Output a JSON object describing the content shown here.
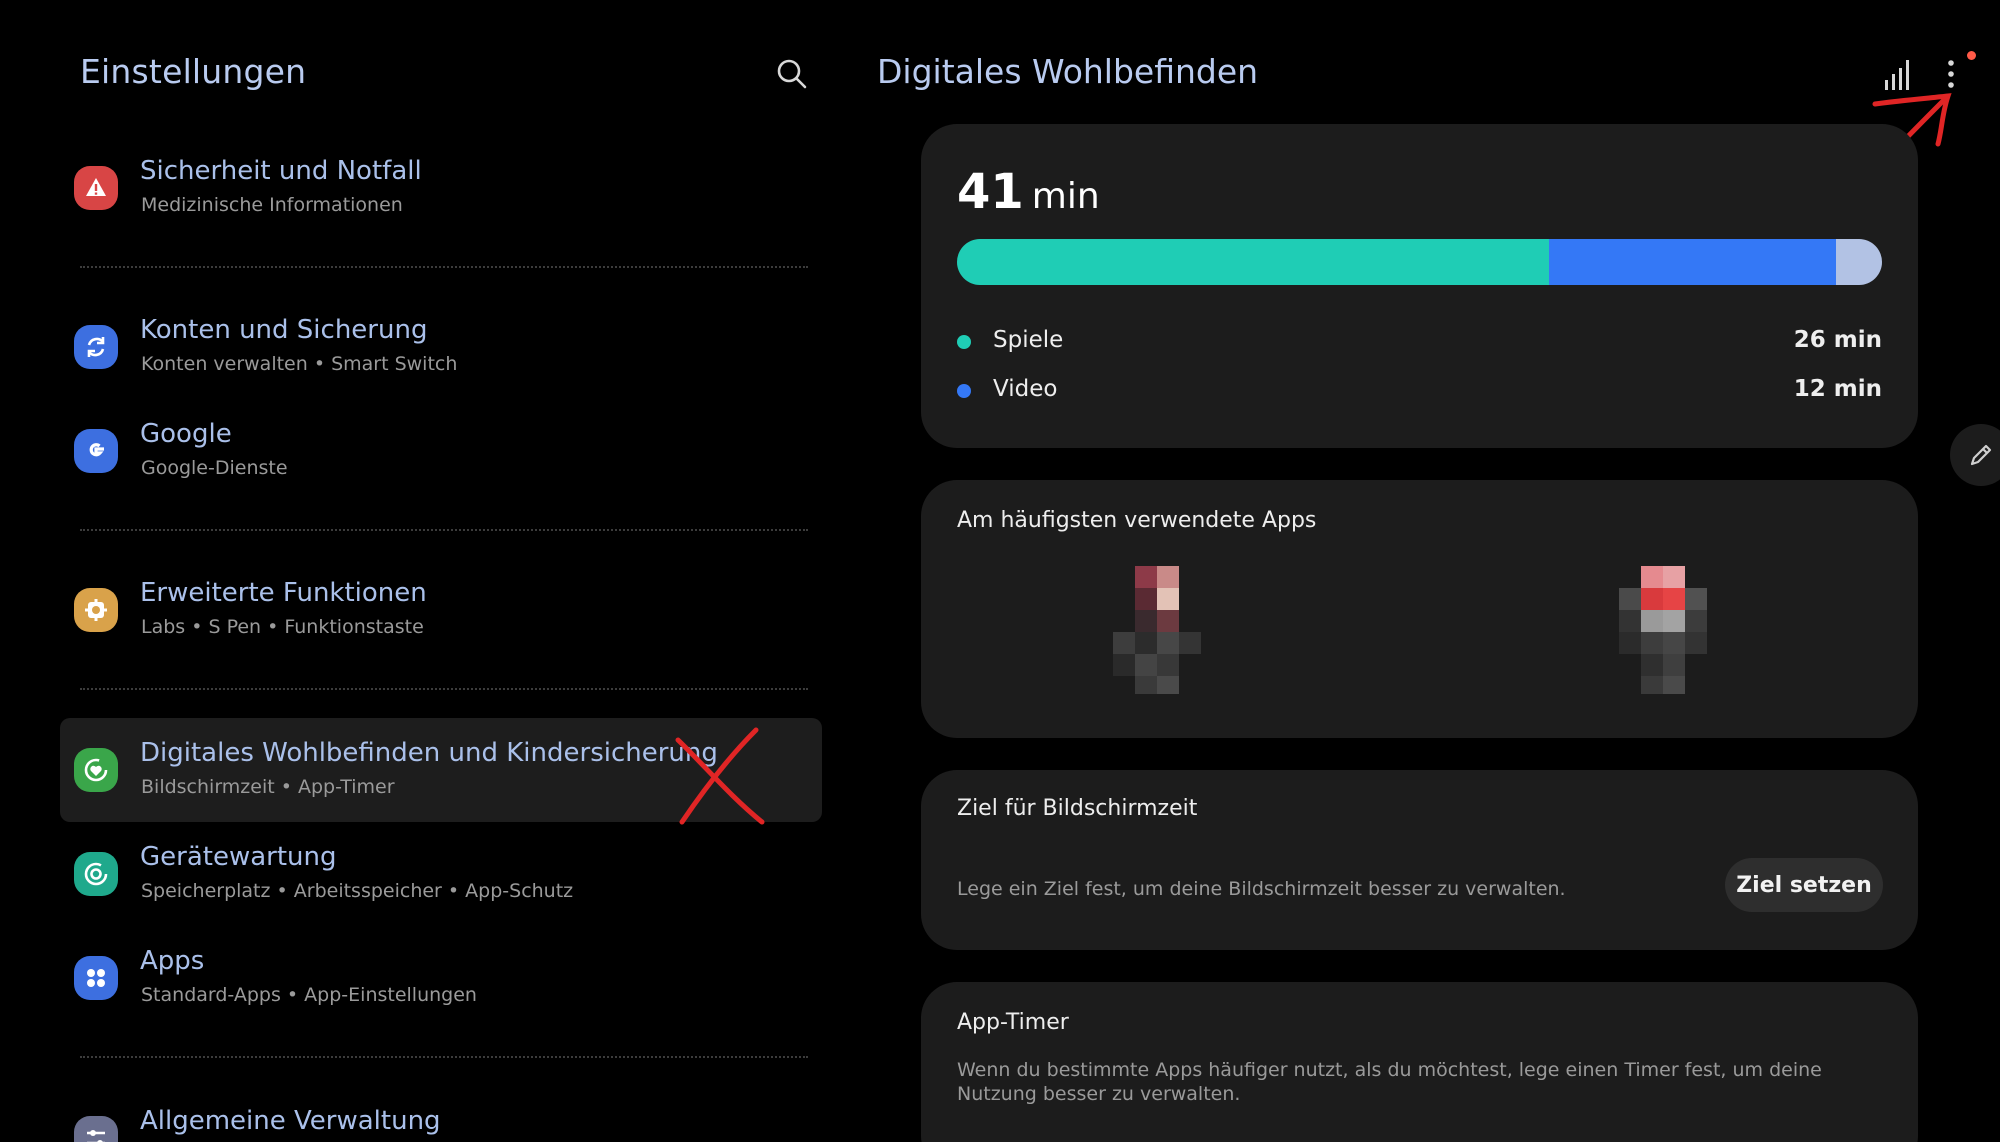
{
  "left": {
    "title": "Einstellungen",
    "items": [
      {
        "title": "Sicherheit und Notfall",
        "subtitle": "Medizinische Informationen",
        "icon": "alert-icon",
        "color": "#d84545"
      },
      {
        "title": "Konten und Sicherung",
        "subtitle": "Konten verwalten  •  Smart Switch",
        "icon": "sync-icon",
        "color": "#3d6fe0"
      },
      {
        "title": "Google",
        "subtitle": "Google-Dienste",
        "icon": "google-icon",
        "color": "#3d6fe0"
      },
      {
        "title": "Erweiterte Funktionen",
        "subtitle": "Labs  •  S Pen  •  Funktionstaste",
        "icon": "puzzle-gear-icon",
        "color": "#d9a24a"
      },
      {
        "title": "Digitales Wohlbefinden und Kindersicherung",
        "subtitle": "Bildschirmzeit  •  App-Timer",
        "icon": "wellbeing-icon",
        "color": "#3aa64a"
      },
      {
        "title": "Gerätewartung",
        "subtitle": "Speicherplatz  •  Arbeitsspeicher  •  App-Schutz",
        "icon": "device-care-icon",
        "color": "#1fa98c"
      },
      {
        "title": "Apps",
        "subtitle": "Standard-Apps  •  App-Einstellungen",
        "icon": "apps-grid-icon",
        "color": "#3d6fe0"
      },
      {
        "title": "Allgemeine Verwaltung",
        "subtitle": "",
        "icon": "sliders-icon",
        "color": "#6a6f8f"
      }
    ]
  },
  "right": {
    "title": "Digitales Wohlbefinden",
    "usage": {
      "total_value": "41",
      "total_unit": "min",
      "bar_fractions": [
        0.64,
        0.31,
        0.05
      ],
      "bar_colors": [
        "#1fcdb5",
        "#3478f6",
        "#b2c2e4"
      ],
      "categories": [
        {
          "label": "Spiele",
          "value": "26 min",
          "color": "#1fcdb5"
        },
        {
          "label": "Video",
          "value": "12 min",
          "color": "#3478f6"
        }
      ]
    },
    "top_apps": {
      "title": "Am häufigsten verwendete Apps"
    },
    "goal": {
      "title": "Ziel für Bildschirmzeit",
      "description": "Lege ein Ziel fest, um deine Bildschirmzeit besser zu verwalten.",
      "button": "Ziel setzen"
    },
    "timer": {
      "title": "App-Timer",
      "description": "Wenn du bestimmte Apps häufiger nutzt, als du möchtest, lege einen Timer fest, um deine Nutzung besser zu verwalten."
    }
  }
}
